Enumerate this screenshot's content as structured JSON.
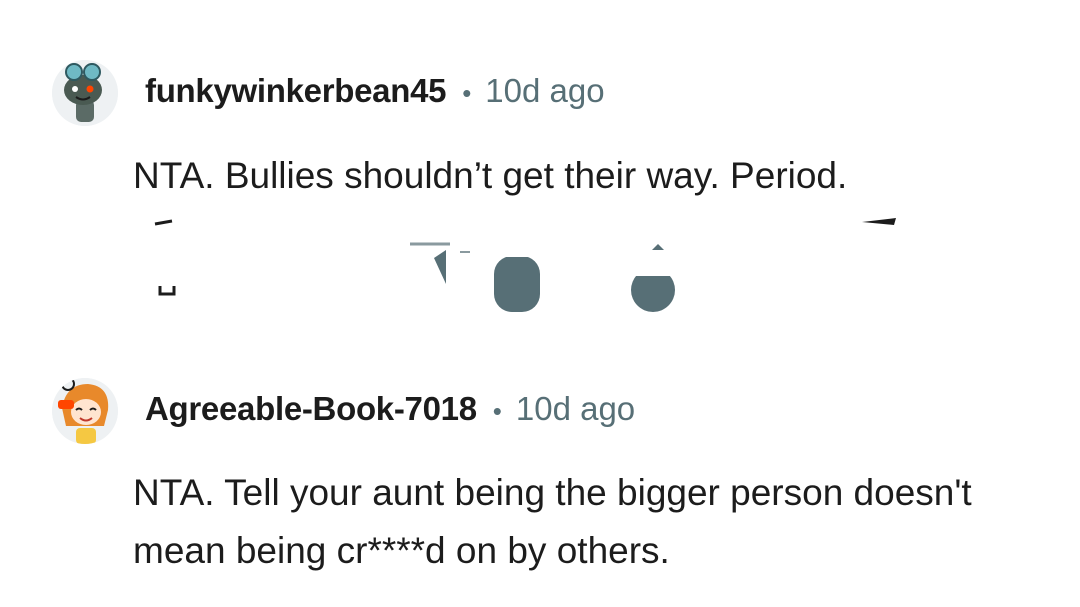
{
  "comments": [
    {
      "username": "funkywinkerbean45",
      "separator": "•",
      "time": "10d ago",
      "text": "NTA. Bullies shouldn’t get their way. Period.",
      "avatar_icon": "snoo-goggles-avatar-icon"
    },
    {
      "username": "Agreeable-Book-7018",
      "separator": "•",
      "time": "10d ago",
      "text": "NTA. Tell your aunt being the bigger person doesn't mean being cr****d on by others.",
      "avatar_icon": "snoo-orange-hair-avatar-icon"
    }
  ],
  "colors": {
    "text": "#1c1c1c",
    "meta": "#576f76",
    "icon": "#576f76"
  }
}
